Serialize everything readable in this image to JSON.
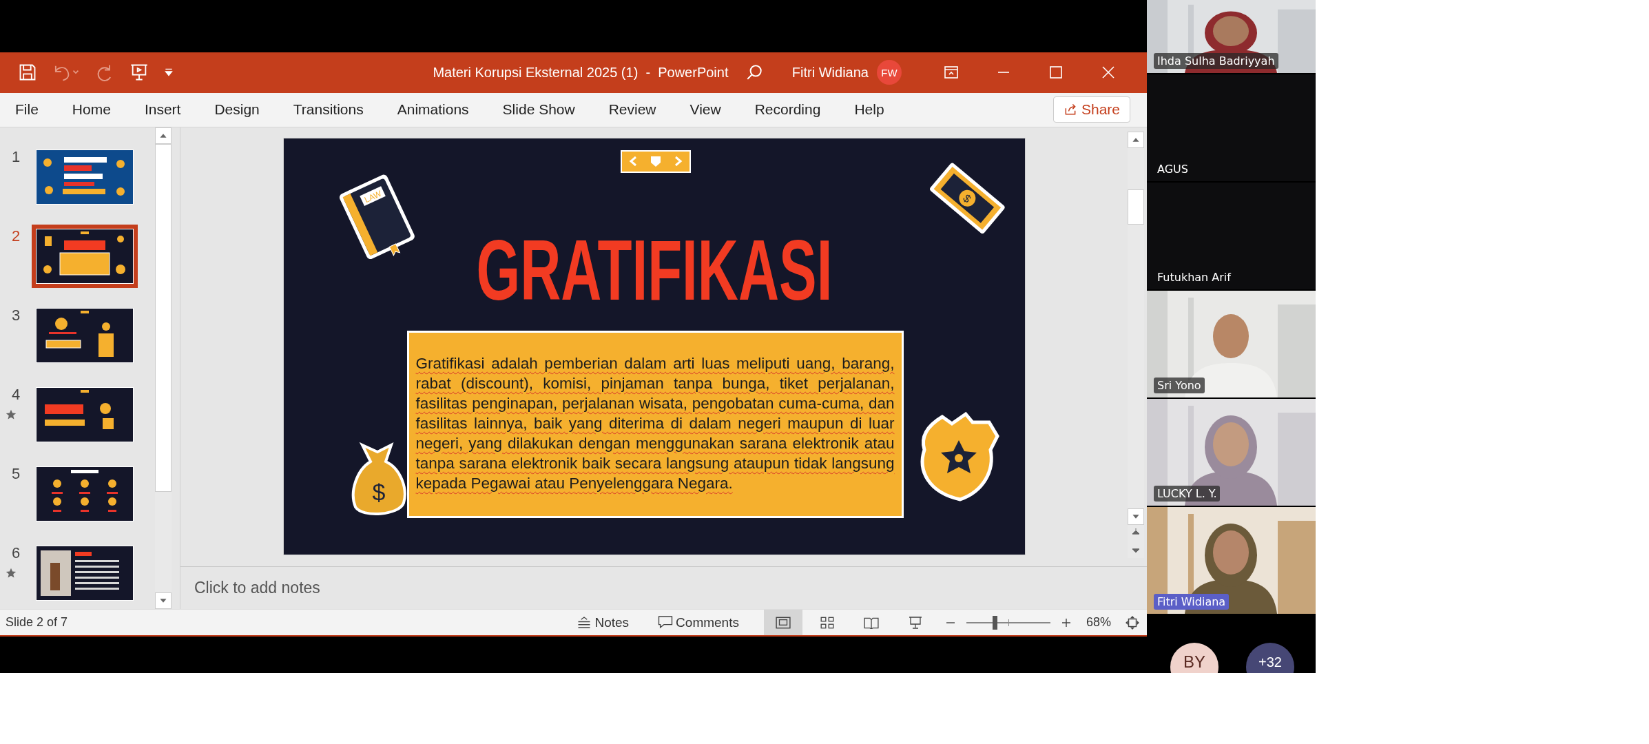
{
  "window": {
    "title": "Materi Korupsi Eksternal 2025 (1)  -  PowerPoint",
    "user_name": "Fitri Widiana",
    "user_initials": "FW",
    "quick_access": [
      {
        "kind": "save",
        "disabled": false
      },
      {
        "kind": "undo",
        "disabled": true
      },
      {
        "kind": "redo",
        "disabled": true
      },
      {
        "kind": "present",
        "disabled": false
      },
      {
        "kind": "customize",
        "disabled": false
      }
    ]
  },
  "ribbon": {
    "tabs": [
      {
        "label": "File"
      },
      {
        "label": "Home"
      },
      {
        "label": "Insert"
      },
      {
        "label": "Design"
      },
      {
        "label": "Transitions"
      },
      {
        "label": "Animations"
      },
      {
        "label": "Slide Show"
      },
      {
        "label": "Review"
      },
      {
        "label": "View"
      },
      {
        "label": "Recording"
      },
      {
        "label": "Help"
      }
    ],
    "share": "Share"
  },
  "thumbnails": [
    {
      "number": "1",
      "selected": false,
      "starred": false
    },
    {
      "number": "2",
      "selected": true,
      "starred": false
    },
    {
      "number": "3",
      "selected": false,
      "starred": false
    },
    {
      "number": "4",
      "selected": false,
      "starred": true
    },
    {
      "number": "5",
      "selected": false,
      "starred": false
    },
    {
      "number": "6",
      "selected": false,
      "starred": true
    }
  ],
  "slide": {
    "title": "GRATIFIKASI",
    "book_label": "LAW",
    "bill_symbol": "$",
    "bag_symbol": "$",
    "body": "Gratifikasi adalah pemberian dalam arti luas meliputi uang, barang, rabat (discount), komisi, pinjaman tanpa bunga, tiket perjalanan, fasilitas penginapan, perjalanan wisata, pengobatan cuma-cuma, dan fasilitas lainnya, baik yang diterima di dalam negeri maupun di luar negeri, yang dilakukan dengan menggunakan sarana elektronik atau tanpa sarana elektronik baik secara langsung ataupun tidak langsung kepada Pegawai atau Penyelenggara Negara."
  },
  "notes": {
    "placeholder": "Click to add notes"
  },
  "status_bar": {
    "slide_info": "Slide 2 of 7",
    "notes": "Notes",
    "comments": "Comments",
    "views": [
      {
        "kind": "normal",
        "selected": true
      },
      {
        "kind": "sorter",
        "selected": false
      },
      {
        "kind": "reading",
        "selected": false
      },
      {
        "kind": "slideshow",
        "selected": false
      }
    ],
    "zoom": {
      "level": 0.34,
      "reading": "68%"
    }
  },
  "participants": [
    {
      "name": "Ihda Sulha Badriyyah",
      "video": true,
      "speaking": false
    },
    {
      "name": "AGUS",
      "video": false,
      "speaking": false
    },
    {
      "name": "Futukhan Arif",
      "video": false,
      "speaking": false
    },
    {
      "name": "Sri Yono",
      "video": true,
      "speaking": false
    },
    {
      "name": "LUCKY L. Y.",
      "video": true,
      "speaking": false
    },
    {
      "name": "Fitri Widiana",
      "video": true,
      "speaking": true
    }
  ],
  "more_participants": [
    {
      "label": "BY",
      "color": "#f0d2cb"
    },
    {
      "label": "+32",
      "color": "#464775"
    }
  ]
}
